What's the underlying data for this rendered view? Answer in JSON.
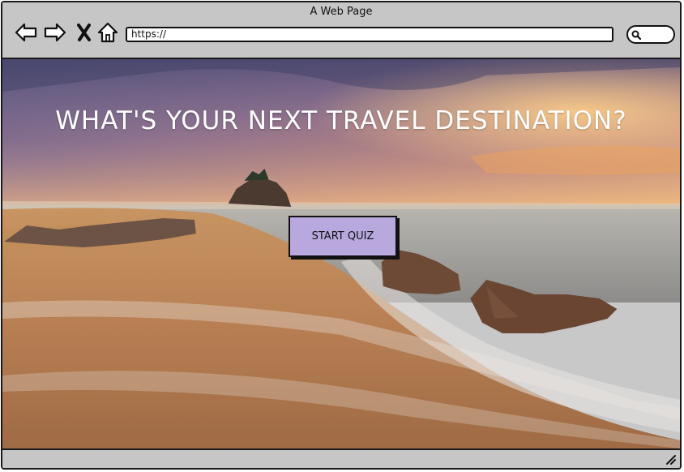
{
  "window": {
    "title": "A Web Page"
  },
  "address_bar": {
    "url": "https://"
  },
  "nav": {
    "back_icon": "arrow-left-icon",
    "forward_icon": "arrow-right-icon",
    "stop_icon": "close-x-icon",
    "home_icon": "home-icon",
    "search_icon": "search-icon"
  },
  "hero": {
    "title": "WHAT'S YOUR NEXT TRAVEL DESTINATION?",
    "background": "beach sunset with rocks and waves",
    "button_label": "START QUIZ",
    "button_color": "#b8a8de"
  }
}
